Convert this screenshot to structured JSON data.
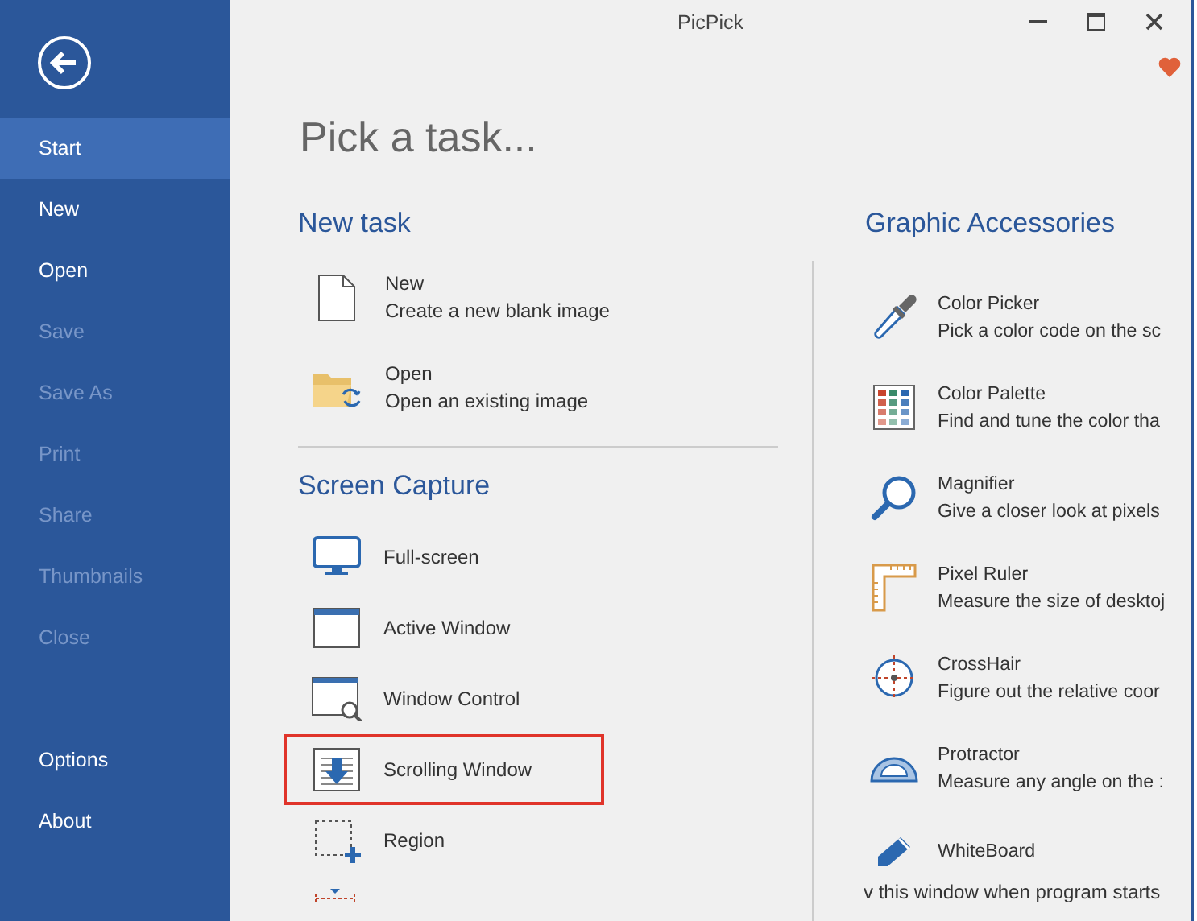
{
  "window": {
    "title": "PicPick"
  },
  "sidebar": {
    "items": [
      {
        "label": "Start",
        "selected": true,
        "disabled": false
      },
      {
        "label": "New",
        "selected": false,
        "disabled": false
      },
      {
        "label": "Open",
        "selected": false,
        "disabled": false
      },
      {
        "label": "Save",
        "selected": false,
        "disabled": true
      },
      {
        "label": "Save As",
        "selected": false,
        "disabled": true
      },
      {
        "label": "Print",
        "selected": false,
        "disabled": true
      },
      {
        "label": "Share",
        "selected": false,
        "disabled": true
      },
      {
        "label": "Thumbnails",
        "selected": false,
        "disabled": true
      },
      {
        "label": "Close",
        "selected": false,
        "disabled": true
      }
    ],
    "bottom_items": [
      {
        "label": "Options"
      },
      {
        "label": "About"
      }
    ]
  },
  "heading": "Pick a task...",
  "new_task": {
    "title": "New task",
    "items": [
      {
        "name": "New",
        "description": "Create a new blank image"
      },
      {
        "name": "Open",
        "description": "Open an existing image"
      }
    ]
  },
  "screen_capture": {
    "title": "Screen Capture",
    "items": [
      {
        "name": "Full-screen",
        "highlighted": false
      },
      {
        "name": "Active Window",
        "highlighted": false
      },
      {
        "name": "Window Control",
        "highlighted": false
      },
      {
        "name": "Scrolling Window",
        "highlighted": true
      },
      {
        "name": "Region",
        "highlighted": false
      }
    ]
  },
  "graphic_accessories": {
    "title": "Graphic Accessories",
    "items": [
      {
        "name": "Color Picker",
        "description": "Pick a color code on the sc"
      },
      {
        "name": "Color Palette",
        "description": "Find and tune the color tha"
      },
      {
        "name": "Magnifier",
        "description": "Give a closer look at pixels"
      },
      {
        "name": "Pixel Ruler",
        "description": "Measure the size of desktoj"
      },
      {
        "name": "CrossHair",
        "description": "Figure out the relative coor"
      },
      {
        "name": "Protractor",
        "description": "Measure any angle on the :"
      },
      {
        "name": "WhiteBoard"
      }
    ]
  },
  "startup_option": "v this window when program starts"
}
